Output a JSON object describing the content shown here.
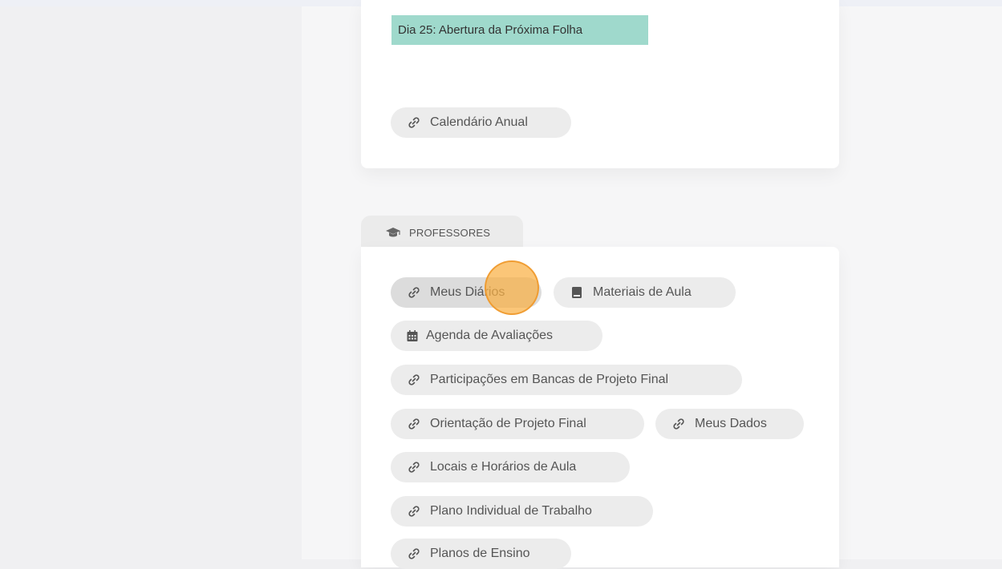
{
  "top_card": {
    "notice_text": "Dia 25: Abertura da Próxima Folha",
    "calendar_link": {
      "label": "Calendário Anual",
      "icon": "link-icon"
    }
  },
  "professores": {
    "tab_label": "PROFESSORES",
    "tab_icon": "graduation-cap-icon",
    "links": [
      {
        "label": "Meus Diários",
        "icon": "link-icon"
      },
      {
        "label": "Materiais de Aula",
        "icon": "book-icon"
      },
      {
        "label": "Agenda de Avaliações",
        "icon": "calendar-icon"
      },
      {
        "label": "Participações em Bancas de Projeto Final",
        "icon": "link-icon"
      },
      {
        "label": "Orientação de Projeto Final",
        "icon": "link-icon"
      },
      {
        "label": "Meus Dados",
        "icon": "link-icon"
      },
      {
        "label": "Locais e Horários de Aula",
        "icon": "link-icon"
      },
      {
        "label": "Plano Individual de Trabalho",
        "icon": "link-icon"
      },
      {
        "label": "Planos de Ensino",
        "icon": "link-icon"
      }
    ]
  },
  "colors": {
    "notice_bg": "#9fd9cc",
    "chip_bg": "#ececec",
    "click_marker": "#fab044"
  }
}
